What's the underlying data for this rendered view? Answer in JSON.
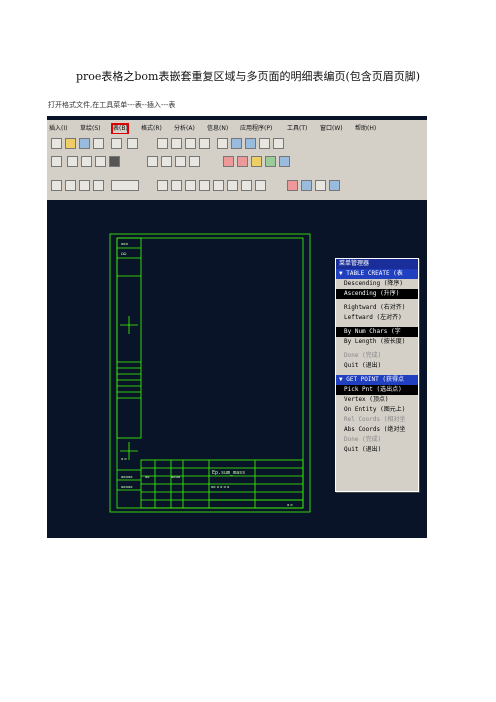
{
  "title": "proe表格之bom表嵌套重复区域与多页面的明细表编页(包含页眉页脚)",
  "subtitle": "打开格式文件,在工具菜单---表--插入---表",
  "menu": {
    "items": [
      "插入(I)",
      "草绘(S)",
      "表(B)",
      "格式(R)",
      "分析(A)",
      "信息(N)",
      "应用程序(P)",
      "工具(T)",
      "窗口(W)",
      "帮助(H)"
    ],
    "highlight_index": 2
  },
  "drawing": {
    "labels": [
      "Ep.sum_mass"
    ]
  },
  "menu_manager": {
    "title": "菜单管理器",
    "section1_header": "▼ TABLE CREATE (表",
    "section1_items": [
      {
        "label": "Descending (降序)",
        "state": "normal"
      },
      {
        "label": "Ascending (升序)",
        "state": "selected"
      },
      {
        "label": "Rightward (右对齐)",
        "state": "normal"
      },
      {
        "label": "Leftward (左对齐)",
        "state": "normal"
      },
      {
        "label": "By Num Chars (字",
        "state": "selected"
      },
      {
        "label": "By Length (按长度)",
        "state": "normal"
      },
      {
        "label": "Done (完成)",
        "state": "dim"
      },
      {
        "label": "Quit (退出)",
        "state": "normal"
      }
    ],
    "section2_header": "▼ GET POINT (获得点",
    "section2_items": [
      {
        "label": "Pick Pnt (选出点)",
        "state": "selected"
      },
      {
        "label": "Vertex (顶点)",
        "state": "normal"
      },
      {
        "label": "On Entity (图元上)",
        "state": "normal"
      },
      {
        "label": "Rel Coords (相对坐",
        "state": "dim"
      },
      {
        "label": "Abs Coords (绝对坐",
        "state": "normal"
      },
      {
        "label": "Done (完成)",
        "state": "dim"
      },
      {
        "label": "Quit (退出)",
        "state": "normal"
      }
    ]
  },
  "colors": {
    "canvas": "#0a1428",
    "frame": "#3cff00",
    "highlight": "#e10000"
  }
}
